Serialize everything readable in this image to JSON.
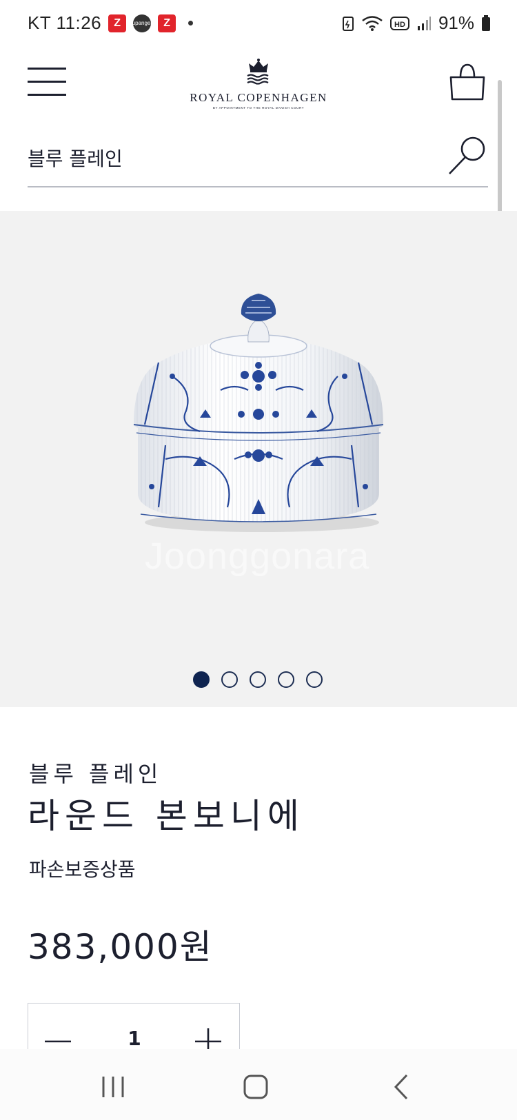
{
  "status_bar": {
    "carrier_time": "KT 11:26",
    "badge1": "Z",
    "badge2_line1": "coupang",
    "badge2_line2": "eats",
    "badge3": "Z",
    "battery": "91%"
  },
  "header": {
    "logo_name": "ROYAL COPENHAGEN",
    "logo_sub": "BY APPOINTMENT TO THE ROYAL DANISH COURT"
  },
  "search": {
    "value": "블루 플레인"
  },
  "gallery": {
    "watermark": "Joonggonara",
    "slide_count": 5,
    "active_slide": 1
  },
  "product": {
    "collection": "블루 플레인",
    "title": "라운드 본보니에",
    "guarantee": "파손보증상품",
    "price": "383,000원",
    "quantity": "1"
  },
  "colors": {
    "navy": "#0f2450",
    "text": "#1c1f2e",
    "gallery_bg": "#f2f2f2"
  }
}
